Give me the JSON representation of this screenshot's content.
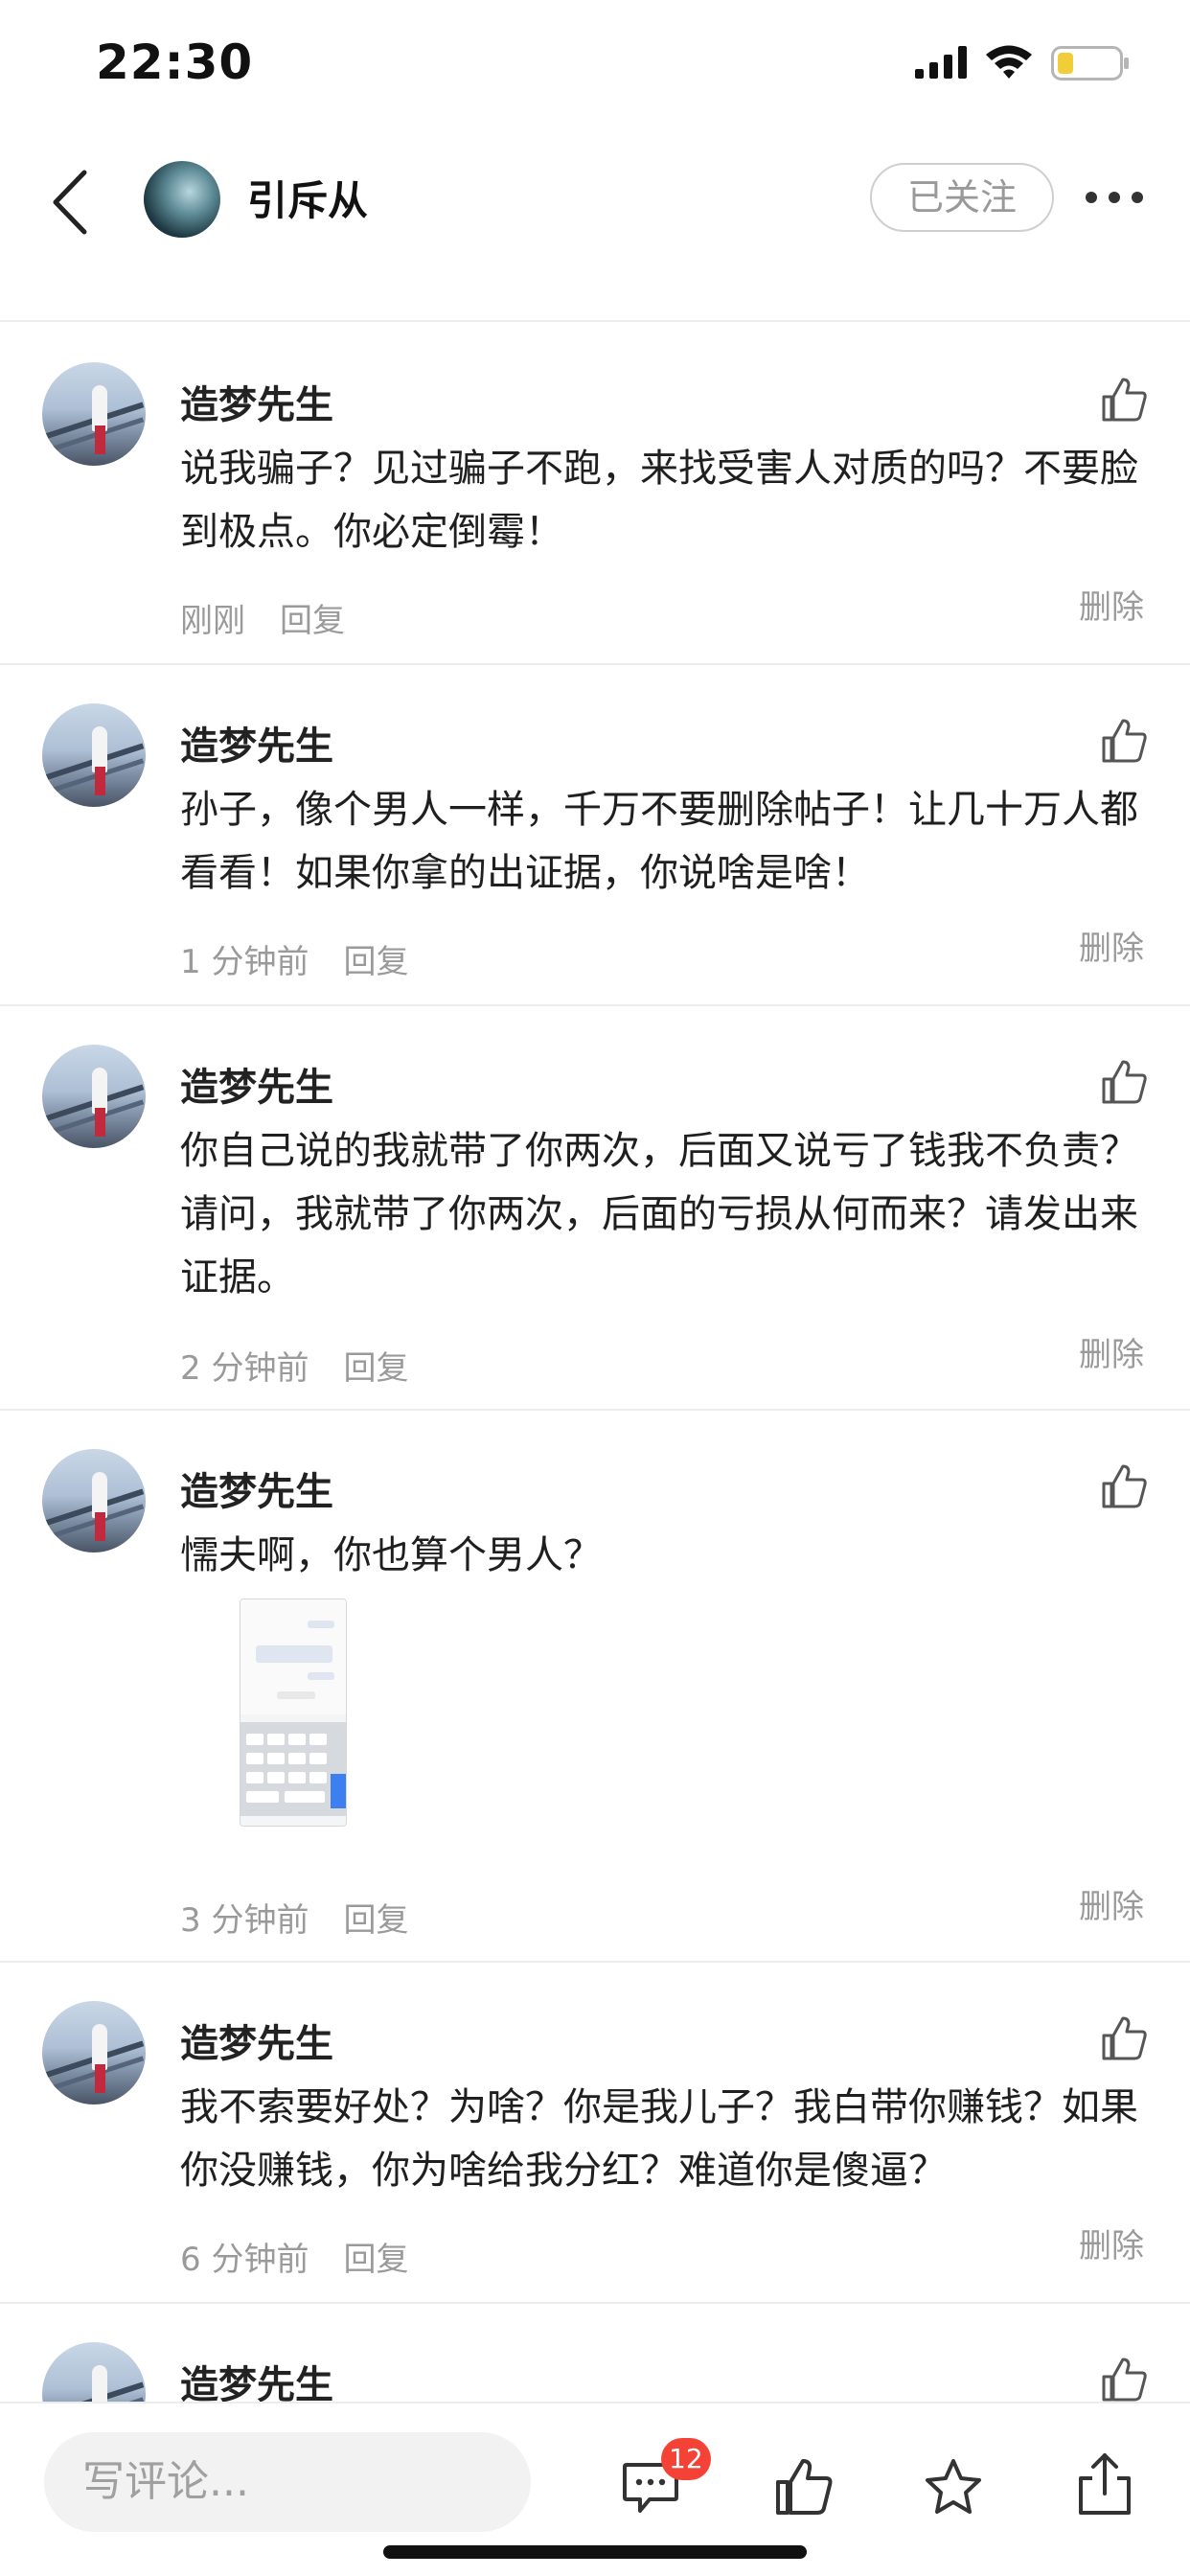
{
  "status_bar": {
    "time": "22:30"
  },
  "header": {
    "username": "引斥从",
    "follow_label": "已关注"
  },
  "comments": [
    {
      "author": "造梦先生",
      "text": "说我骗子？见过骗子不跑，来找受害人对质的吗？不要脸到极点。你必定倒霉！",
      "time": "刚刚",
      "reply_label": "回复",
      "delete_label": "删除"
    },
    {
      "author": "造梦先生",
      "text": "孙子，像个男人一样，千万不要删除帖子！让几十万人都看看！如果你拿的出证据，你说啥是啥！",
      "time": "1 分钟前",
      "reply_label": "回复",
      "delete_label": "删除"
    },
    {
      "author": "造梦先生",
      "text": "你自己说的我就带了你两次，后面又说亏了钱我不负责？请问，我就带了你两次，后面的亏损从何而来？请发出来证据。",
      "time": "2 分钟前",
      "reply_label": "回复",
      "delete_label": "删除"
    },
    {
      "author": "造梦先生",
      "text": "懦夫啊，你也算个男人？",
      "time": "3 分钟前",
      "reply_label": "回复",
      "delete_label": "删除"
    },
    {
      "author": "造梦先生",
      "text": "我不索要好处？为啥？你是我儿子？我白带你赚钱？如果你没赚钱，你为啥给我分红？难道你是傻逼？",
      "time": "6 分钟前",
      "reply_label": "回复",
      "delete_label": "删除"
    },
    {
      "author": "造梦先生"
    }
  ],
  "bottom_bar": {
    "input_placeholder": "写评论...",
    "comment_count": "12"
  },
  "colors": {
    "badge": "#f44336",
    "divider": "#ededed",
    "muted_text": "#9a9a9a"
  }
}
